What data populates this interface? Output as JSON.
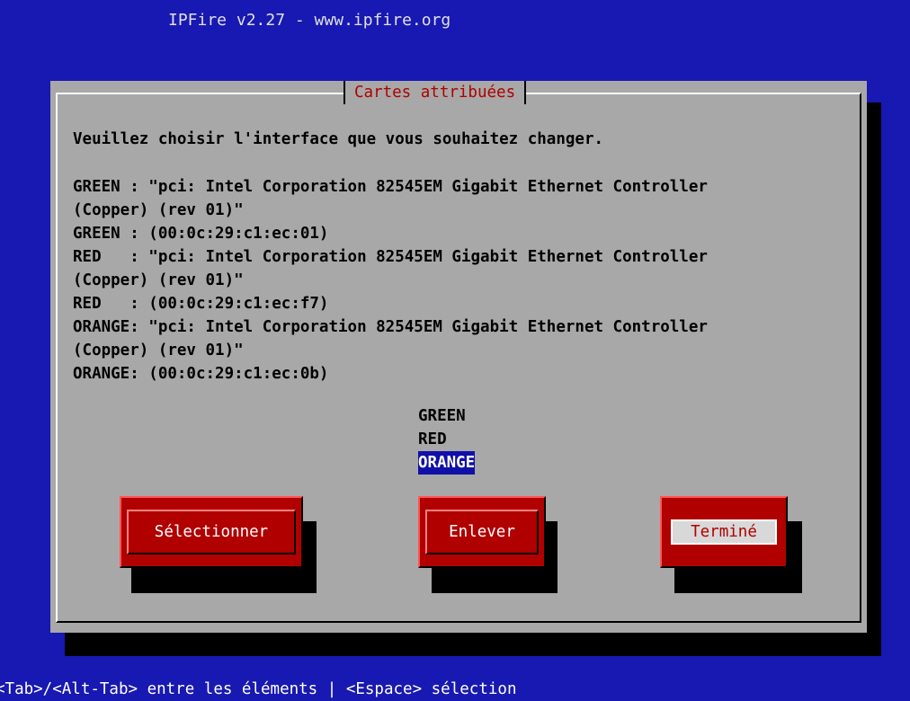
{
  "window": {
    "root_title": "IPFire v2.27 - www.ipfire.org"
  },
  "dialog": {
    "title": "Cartes attribuées",
    "prompt": "Veuillez choisir l'interface que vous souhaitez changer.",
    "info_lines": [
      "GREEN : \"pci: Intel Corporation 82545EM Gigabit Ethernet Controller",
      "(Copper) (rev 01)\"",
      "GREEN : (00:0c:29:c1:ec:01)",
      "RED   : \"pci: Intel Corporation 82545EM Gigabit Ethernet Controller",
      "(Copper) (rev 01)\"",
      "RED   : (00:0c:29:c1:ec:f7)",
      "ORANGE: \"pci: Intel Corporation 82545EM Gigabit Ethernet Controller",
      "(Copper) (rev 01)\"",
      "ORANGE: (00:0c:29:c1:ec:0b)"
    ],
    "list": {
      "items": [
        "GREEN",
        "RED",
        "ORANGE"
      ],
      "selected": "ORANGE"
    },
    "buttons": {
      "select": "Sélectionner",
      "remove": "Enlever",
      "done": "Terminé"
    }
  },
  "status_bar": {
    "text": "<Tab>/<Alt-Tab> entre les éléments | <Espace> sélection"
  },
  "colors": {
    "desktop": "#1818b2",
    "dialog_bg": "#a8a8a8",
    "accent_red": "#b00000",
    "selection": "#1010a8"
  }
}
